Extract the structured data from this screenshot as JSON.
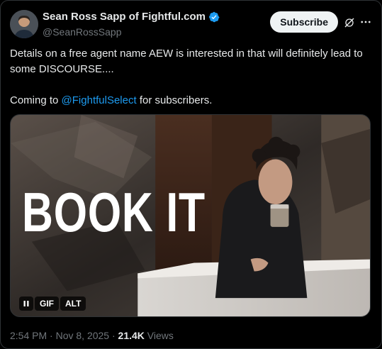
{
  "author": {
    "display_name": "Sean Ross Sapp of Fightful.com",
    "handle": "@SeanRossSapp",
    "verified": true
  },
  "actions": {
    "subscribe_label": "Subscribe",
    "grok_icon": "grok-icon",
    "more_icon": "more-icon"
  },
  "tweet": {
    "line1": "Details on a free agent name AEW is interested in that will definitely lead to some DISCOURSE....",
    "line2_prefix": "Coming to ",
    "mention": "@FightfulSelect",
    "line2_suffix": " for subscribers."
  },
  "media": {
    "overlay_text": "BOOK IT",
    "pause_icon": "pause-icon",
    "gif_label": "GIF",
    "alt_label": "ALT"
  },
  "meta": {
    "time": "2:54 PM",
    "sep1": " · ",
    "date": "Nov 8, 2025",
    "sep2": " · ",
    "views_count": "21.4K",
    "views_label": " Views"
  },
  "colors": {
    "accent": "#1d9bf0",
    "background": "#000000",
    "text": "#e7e9ea",
    "muted": "#71767b"
  }
}
